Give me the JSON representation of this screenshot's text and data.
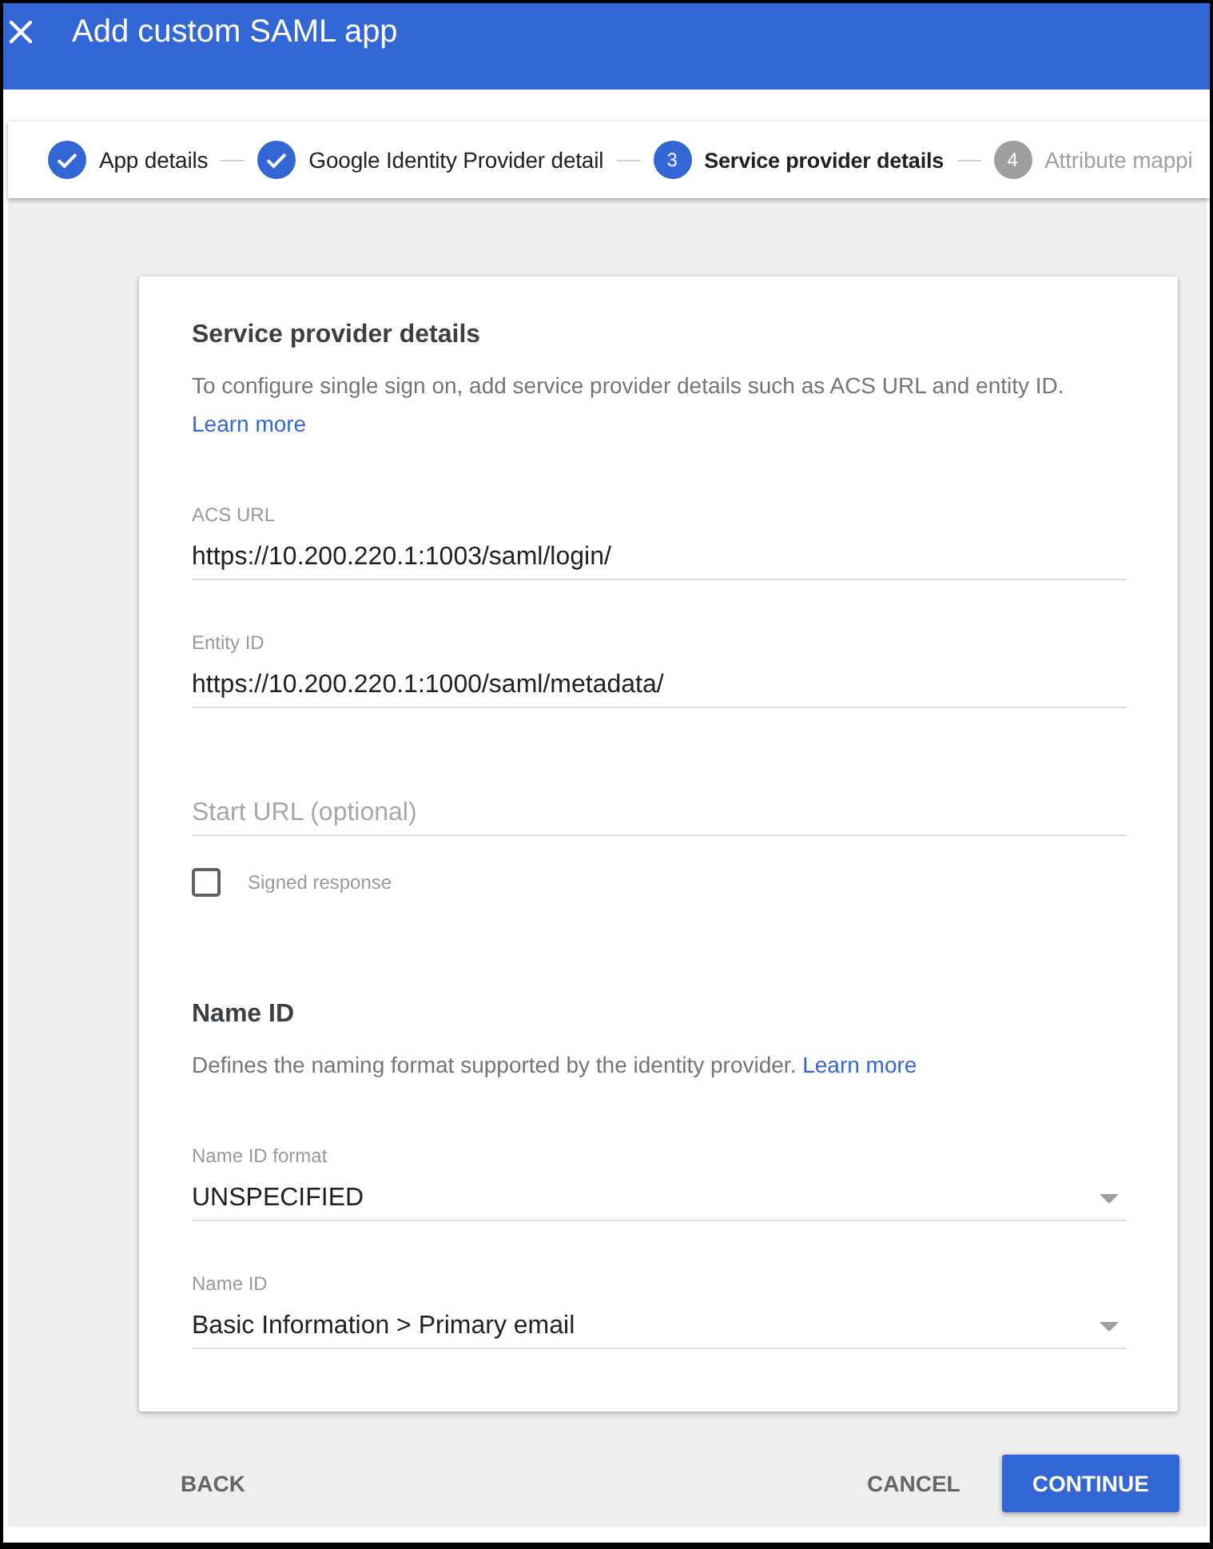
{
  "header": {
    "title": "Add custom SAML app"
  },
  "stepper": {
    "steps": [
      {
        "label": "App details",
        "completed": true,
        "selected": false
      },
      {
        "label": "Google Identity Provider detail",
        "completed": true,
        "selected": false
      },
      {
        "number": "3",
        "label": "Service provider details",
        "completed": false,
        "selected": true
      },
      {
        "number": "4",
        "label": "Attribute mappi",
        "completed": false,
        "selected": false
      }
    ]
  },
  "sections": [
    {
      "title": "Service provider details",
      "description": "To configure single sign on, add service provider details such as ACS URL and entity ID.",
      "link": "Learn more",
      "fields": [
        {
          "kind": "text",
          "label": "ACS URL",
          "value": "https://10.200.220.1:1003/saml/login/"
        },
        {
          "kind": "text",
          "label": "Entity ID",
          "value": "https://10.200.220.1:1000/saml/metadata/"
        },
        {
          "kind": "text",
          "placeholder": "Start URL (optional)"
        },
        {
          "kind": "checkbox",
          "label": "Signed response",
          "checked": false
        }
      ]
    },
    {
      "title": "Name ID",
      "description": "Defines the naming format supported by the identity provider.",
      "link": "Learn more",
      "fields": [
        {
          "kind": "dropdown",
          "label": "Name ID format",
          "value": "UNSPECIFIED"
        },
        {
          "kind": "dropdown",
          "label": "Name ID",
          "value": "Basic Information > Primary email"
        }
      ]
    }
  ],
  "footer": {
    "left_buttons": [
      {
        "kind": "flat",
        "label": "BACK"
      }
    ],
    "right_buttons": [
      {
        "kind": "flat",
        "label": "CANCEL"
      },
      {
        "kind": "raised",
        "label": "CONTINUE"
      }
    ]
  }
}
